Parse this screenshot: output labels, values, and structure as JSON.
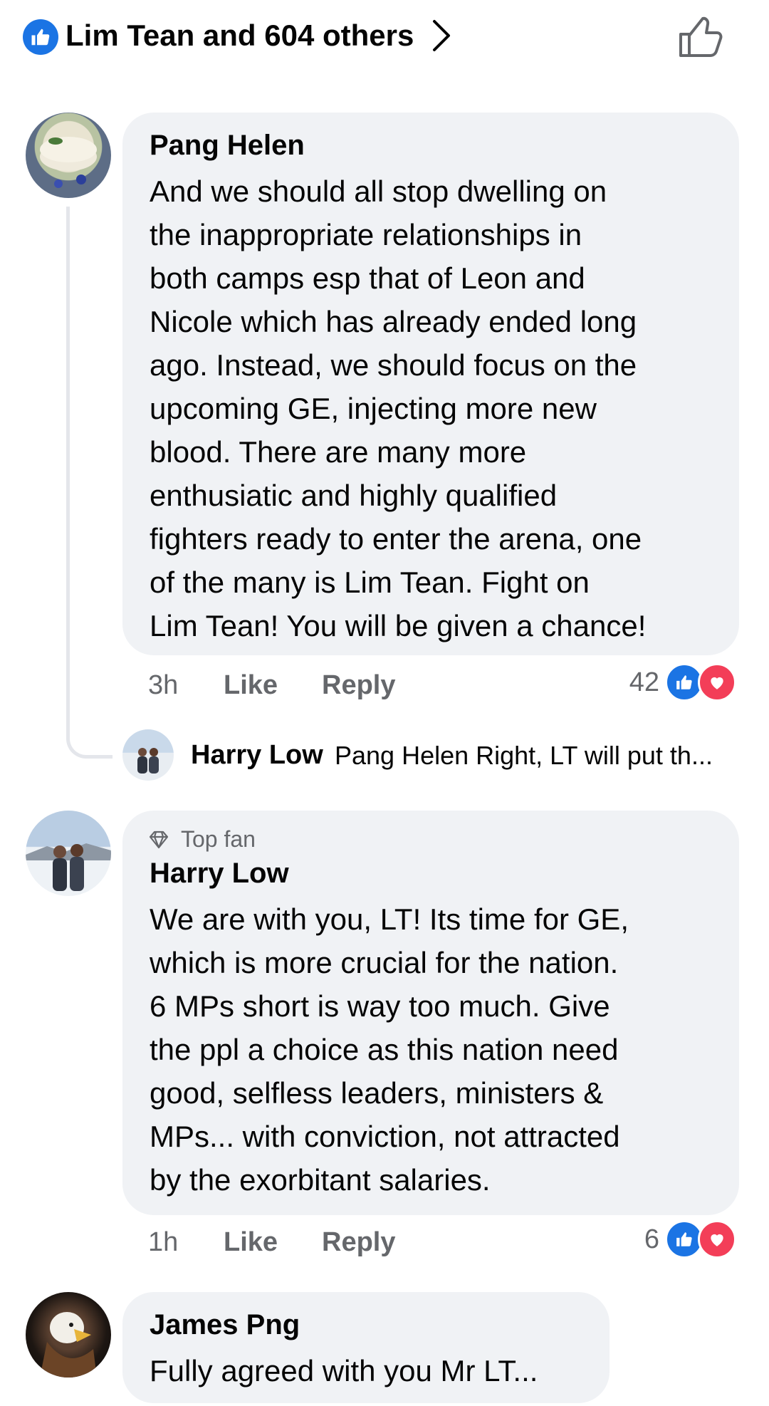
{
  "header": {
    "reactors_text": "Lim Tean and 604 others"
  },
  "comments": [
    {
      "author": "Pang Helen",
      "text": "And we should all stop dwelling on\nthe inappropriate relationships in\nboth camps esp that of Leon and\nNicole which has already ended long\nago. Instead, we should focus on the\nupcoming GE, injecting more new\nblood.  There are many more\nenthusiatic and highly qualified\nfighters ready to enter the arena, one\nof the many is Lim Tean.  Fight on\nLim Tean! You will be given a chance!",
      "time": "3h",
      "like_label": "Like",
      "reply_label": "Reply",
      "reaction_count": "42",
      "reply_preview": {
        "author": "Harry Low",
        "text": "Pang Helen Right, LT will put th..."
      }
    },
    {
      "badge": "Top fan",
      "author": "Harry Low",
      "text": "We are with you, LT! Its time for GE,\nwhich is more crucial for the nation.\n6 MPs short is way too much. Give\nthe ppl a choice as this nation need\ngood, selfless leaders, ministers &\nMPs... with conviction, not attracted\nby the exorbitant salaries.",
      "time": "1h",
      "like_label": "Like",
      "reply_label": "Reply",
      "reaction_count": "6"
    },
    {
      "author": "James Png",
      "text": "Fully agreed with you Mr LT..."
    }
  ],
  "colors": {
    "accent_blue": "#1b74e4",
    "love_red": "#f33e58",
    "bubble_bg": "#f0f2f5",
    "meta_gray": "#65676b"
  }
}
